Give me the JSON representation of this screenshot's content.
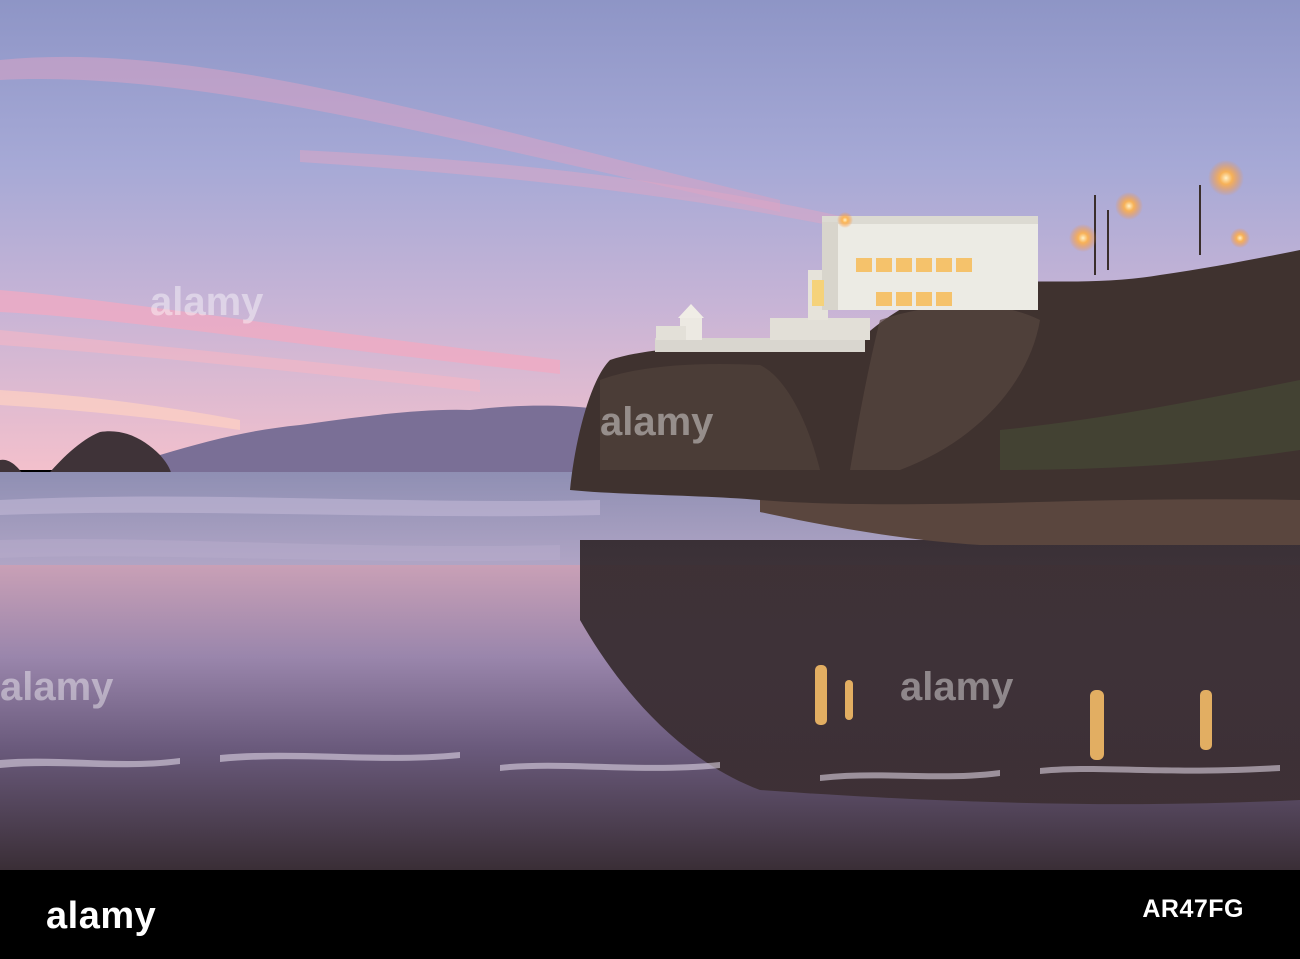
{
  "branding": {
    "logo_text": "alamy",
    "image_id": "AR47FG"
  },
  "colors": {
    "sky_top": "#8f97c8",
    "sky_horizon": "#f2b6c6",
    "sea": "#9b95b8",
    "sand_dark": "#3b2f31",
    "cliff": "#4a3b36",
    "building": "#eceae2",
    "window_glow": "#f5c26b",
    "streetlight": "#ffb24a",
    "footer_bar": "#000000"
  }
}
